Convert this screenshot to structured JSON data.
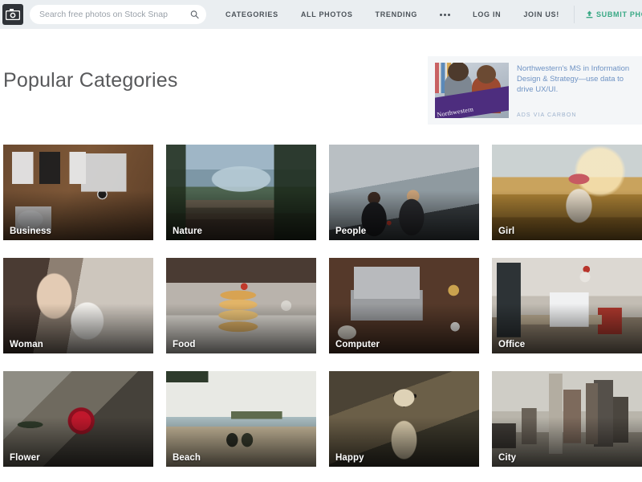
{
  "header": {
    "logo_icon": "camera-icon",
    "search": {
      "placeholder": "Search free photos on Stock Snap",
      "value": "",
      "icon": "search-icon"
    },
    "nav": [
      {
        "label": "CATEGORIES"
      },
      {
        "label": "ALL PHOTOS"
      },
      {
        "label": "TRENDING"
      }
    ],
    "more_icon": "ellipsis-icon",
    "account": [
      {
        "label": "LOG IN"
      },
      {
        "label": "JOIN US!"
      }
    ],
    "submit": {
      "label": "SUBMIT PHOTOS",
      "icon": "upload-icon",
      "color": "#38a884"
    },
    "background": "#eaeef1"
  },
  "page": {
    "title": "Popular Categories"
  },
  "ad": {
    "text": "Northwestern's MS in Information Design & Strategy—use data to drive UX/UI.",
    "carbon_label": "ADS VIA CARBON",
    "thumb_brand": "Northwestern",
    "text_color": "#6f93c4",
    "background": "#f4f6f8"
  },
  "categories": [
    {
      "label": "Business",
      "art": "art-business"
    },
    {
      "label": "Nature",
      "art": "art-nature"
    },
    {
      "label": "People",
      "art": "art-people"
    },
    {
      "label": "Girl",
      "art": "art-girl"
    },
    {
      "label": "Woman",
      "art": "art-woman"
    },
    {
      "label": "Food",
      "art": "art-food"
    },
    {
      "label": "Computer",
      "art": "art-computer"
    },
    {
      "label": "Office",
      "art": "art-office"
    },
    {
      "label": "Flower",
      "art": "art-flower"
    },
    {
      "label": "Beach",
      "art": "art-beach"
    },
    {
      "label": "Happy",
      "art": "art-happy"
    },
    {
      "label": "City",
      "art": "art-city"
    }
  ]
}
